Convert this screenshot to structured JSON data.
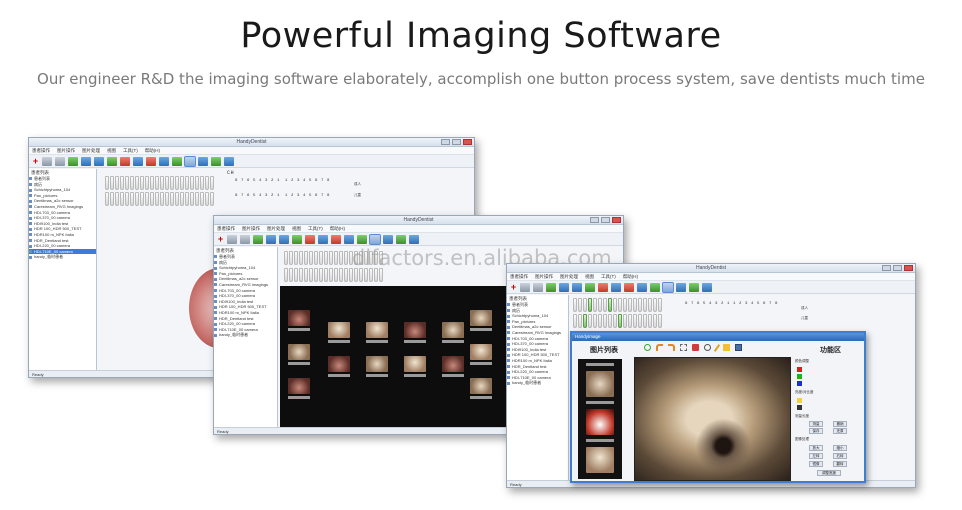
{
  "heading": {
    "title": "Powerful Imaging Software",
    "subtitle": "Our engineer R&D the imaging software elaborately, accomplish one button process system, save dentists much time"
  },
  "watermark": "dlfactors.en.alibaba.com",
  "app": {
    "window_title": "HandyDentist",
    "menu": [
      "患者操作",
      "图片操作",
      "图片处理",
      "视图",
      "工具(T)",
      "帮助(H)"
    ],
    "status": "Ready",
    "tree_title": "患者列表",
    "tree_items": [
      "患者列表",
      "病历",
      "Schichtpyhoma_104",
      "Pan_pictures",
      "Dentlimas_a2c sensor",
      "Carestream_RVG Imagings",
      "HDI-703_00 camera",
      "HDI-370_00 camera",
      "HDI9100_India test",
      "HDR 100_HDR 500_TEST",
      "HDR100 m_NPK Italia",
      "HDR_Dentland test",
      "HDI-220_00 camera",
      "HDI-710E_00 camera",
      "handy_临时患者"
    ],
    "tooth_chart_label": "CH",
    "tooth_numbers_left": "8 7 6 5 4 3 2 1",
    "tooth_numbers_right": "1 2 3 4 5 6 7 8",
    "radio_options": [
      "成人",
      "儿童"
    ]
  },
  "viewer_dialog": {
    "title": "HandyImage",
    "list_header": "图片列表",
    "tools_header": "功能区",
    "section_color": "颜色调整",
    "section_contrast": "亮度/对比度",
    "section_measure": "测量长度",
    "section_filter": "图像处理",
    "buttons": [
      "测量",
      "撤销",
      "保存",
      "还原",
      "放大",
      "缩小",
      "左转",
      "右转",
      "镜像",
      "翻转",
      "调整宽度"
    ],
    "colors": {
      "red": "#e21b1b",
      "green": "#1bb51b",
      "blue": "#1b2fd6"
    }
  }
}
